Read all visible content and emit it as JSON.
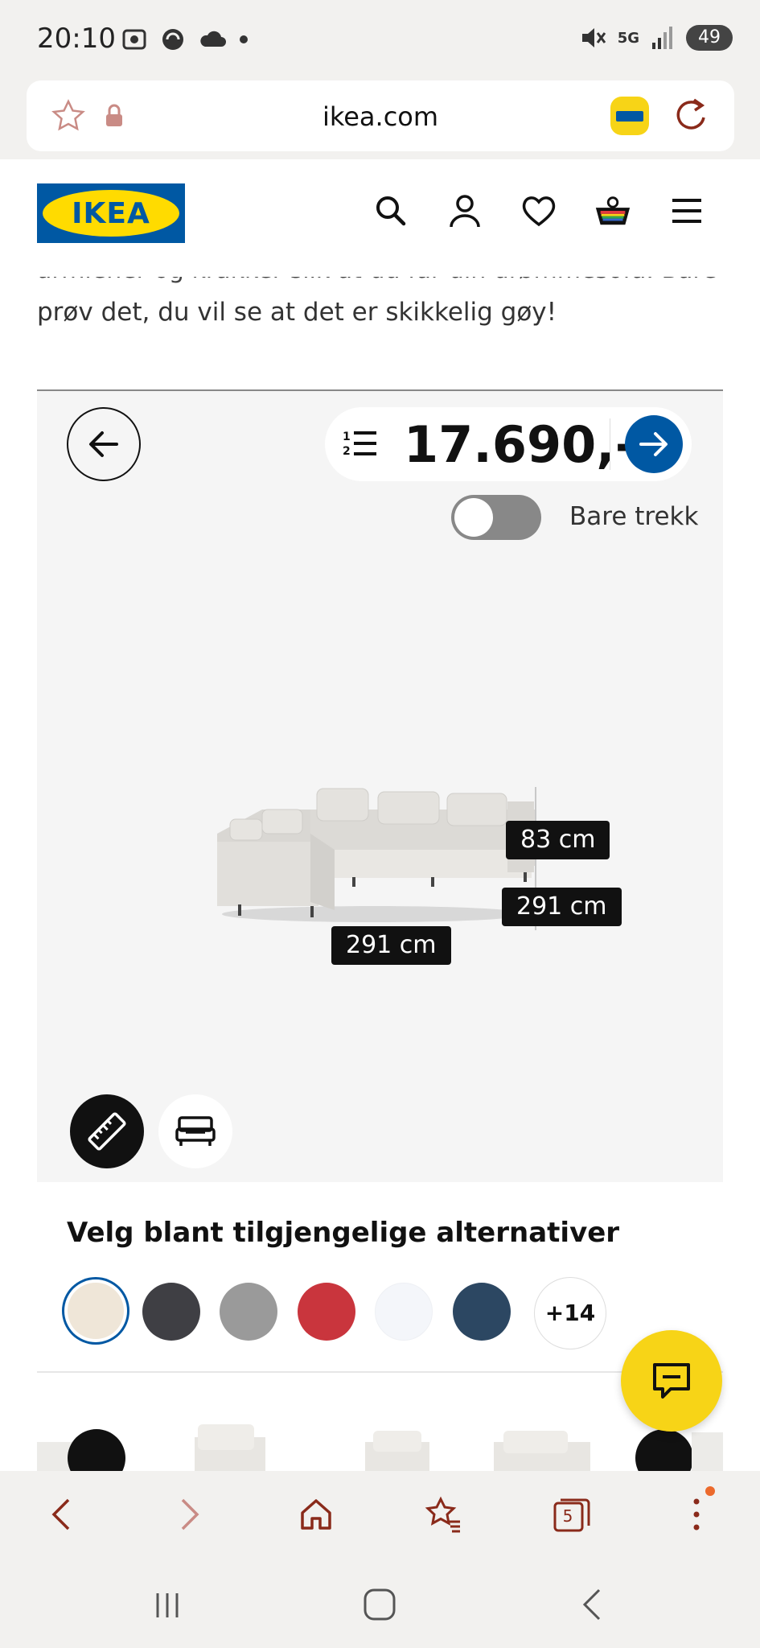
{
  "status_bar": {
    "time": "20:10",
    "network": "5G",
    "battery": "49",
    "icons": [
      "screenshot-icon",
      "sync-icon",
      "cloud-icon",
      "dot-icon",
      "mute-icon",
      "signal-icon",
      "battery-icon"
    ]
  },
  "browser": {
    "url": "ikea.com",
    "tab_count": "5",
    "icons": [
      "star-icon",
      "lock-icon",
      "ikea-app-icon",
      "reload-icon"
    ]
  },
  "header": {
    "logo_text": "IKEA",
    "icons": [
      "search-icon",
      "account-icon",
      "wishlist-heart-icon",
      "basket-icon",
      "menu-icon"
    ]
  },
  "intro": {
    "cut_line": "armlener og krakker slik at du får din drømmesofa. Bare",
    "line": "prøv det, du vil se at det er skikkelig gøy!"
  },
  "configurator": {
    "price": "17.690,-",
    "toggle_label": "Bare trekk",
    "toggle_on": false,
    "dimensions": {
      "height": "83 cm",
      "depth": "291 cm",
      "width": "291 cm"
    }
  },
  "alternatives": {
    "title": "Velg blant tilgjengelige alternativer",
    "swatches": [
      {
        "color": "#efe6d8",
        "selected": true
      },
      {
        "color": "#3f3f44",
        "selected": false
      },
      {
        "color": "#9a9a9a",
        "selected": false
      },
      {
        "color": "#c9353d",
        "selected": false
      },
      {
        "color": "#f4f6fa",
        "selected": false
      },
      {
        "color": "#2c4762",
        "selected": false
      }
    ],
    "more_label": "+14"
  },
  "colors": {
    "ikea_blue": "#0058a3",
    "ikea_yellow": "#f7d417",
    "browser_accent": "#8a2a1a"
  }
}
